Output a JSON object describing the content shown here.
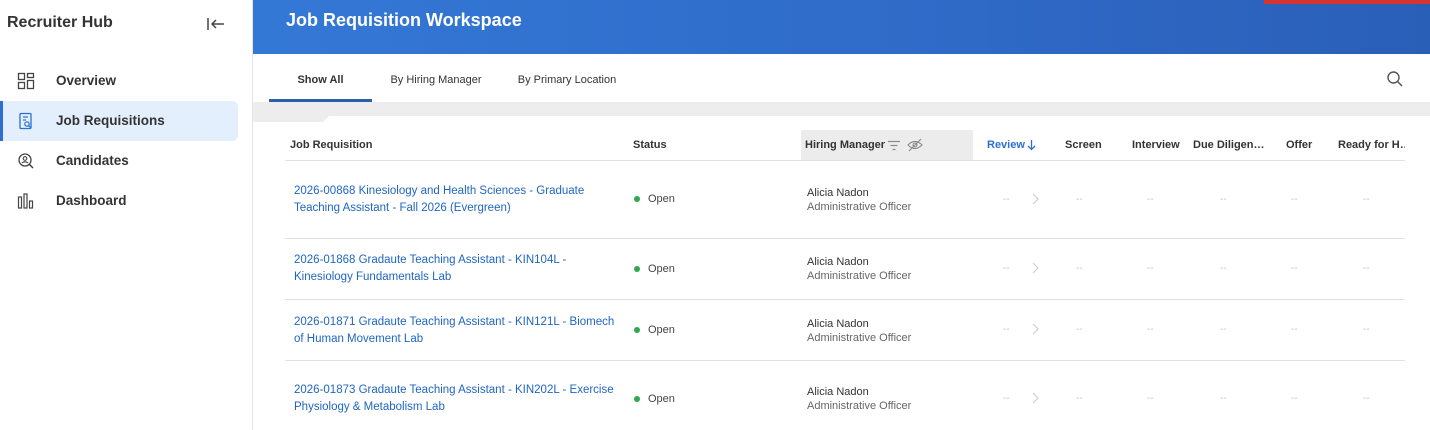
{
  "sidebar": {
    "title": "Recruiter Hub",
    "collapse_icon": "collapse-left-icon",
    "items": [
      {
        "label": "Overview",
        "icon": "grid-icon",
        "active": false
      },
      {
        "label": "Job Requisitions",
        "icon": "requisition-icon",
        "active": true
      },
      {
        "label": "Candidates",
        "icon": "candidate-search-icon",
        "active": false
      },
      {
        "label": "Dashboard",
        "icon": "bar-chart-icon",
        "active": false
      }
    ]
  },
  "header": {
    "title": "Job Requisition Workspace"
  },
  "tabs": [
    {
      "label": "Show All",
      "active": true
    },
    {
      "label": "By Hiring Manager",
      "active": false
    },
    {
      "label": "By Primary Location",
      "active": false
    }
  ],
  "table": {
    "columns": [
      {
        "label": "Job Requisition"
      },
      {
        "label": "Status"
      },
      {
        "label": "Hiring Manager"
      },
      {
        "label": "Review",
        "sort": "descending"
      },
      {
        "label": "Screen"
      },
      {
        "label": "Interview"
      },
      {
        "label": "Due Diligen…"
      },
      {
        "label": "Offer"
      },
      {
        "label": "Ready for H…"
      }
    ],
    "empty_value": "--",
    "rows": [
      {
        "requisition": "2026-00868 Kinesiology and Health Sciences - Graduate Teaching Assistant - Fall 2026 (Evergreen)",
        "status": "Open",
        "manager_name": "Alicia Nadon",
        "manager_title": "Administrative Officer"
      },
      {
        "requisition": "2026-01868 Gradaute Teaching Assistant - KIN104L - Kinesiology Fundamentals Lab",
        "status": "Open",
        "manager_name": "Alicia Nadon",
        "manager_title": "Administrative Officer"
      },
      {
        "requisition": "2026-01871 Gradaute Teaching Assistant - KIN121L - Biomech of Human Movement Lab",
        "status": "Open",
        "manager_name": "Alicia Nadon",
        "manager_title": "Administrative Officer"
      },
      {
        "requisition": "2026-01873 Gradaute Teaching Assistant - KIN202L - Exercise Physiology & Metabolism Lab",
        "status": "Open",
        "manager_name": "Alicia Nadon",
        "manager_title": "Administrative Officer"
      }
    ]
  },
  "colors": {
    "accent": "#2b6fd0",
    "header_start": "#3478d6",
    "header_end": "#2a5fb8",
    "status_open": "#2fa84f",
    "link": "#1f65c3",
    "alert_bar": "#d63333"
  }
}
